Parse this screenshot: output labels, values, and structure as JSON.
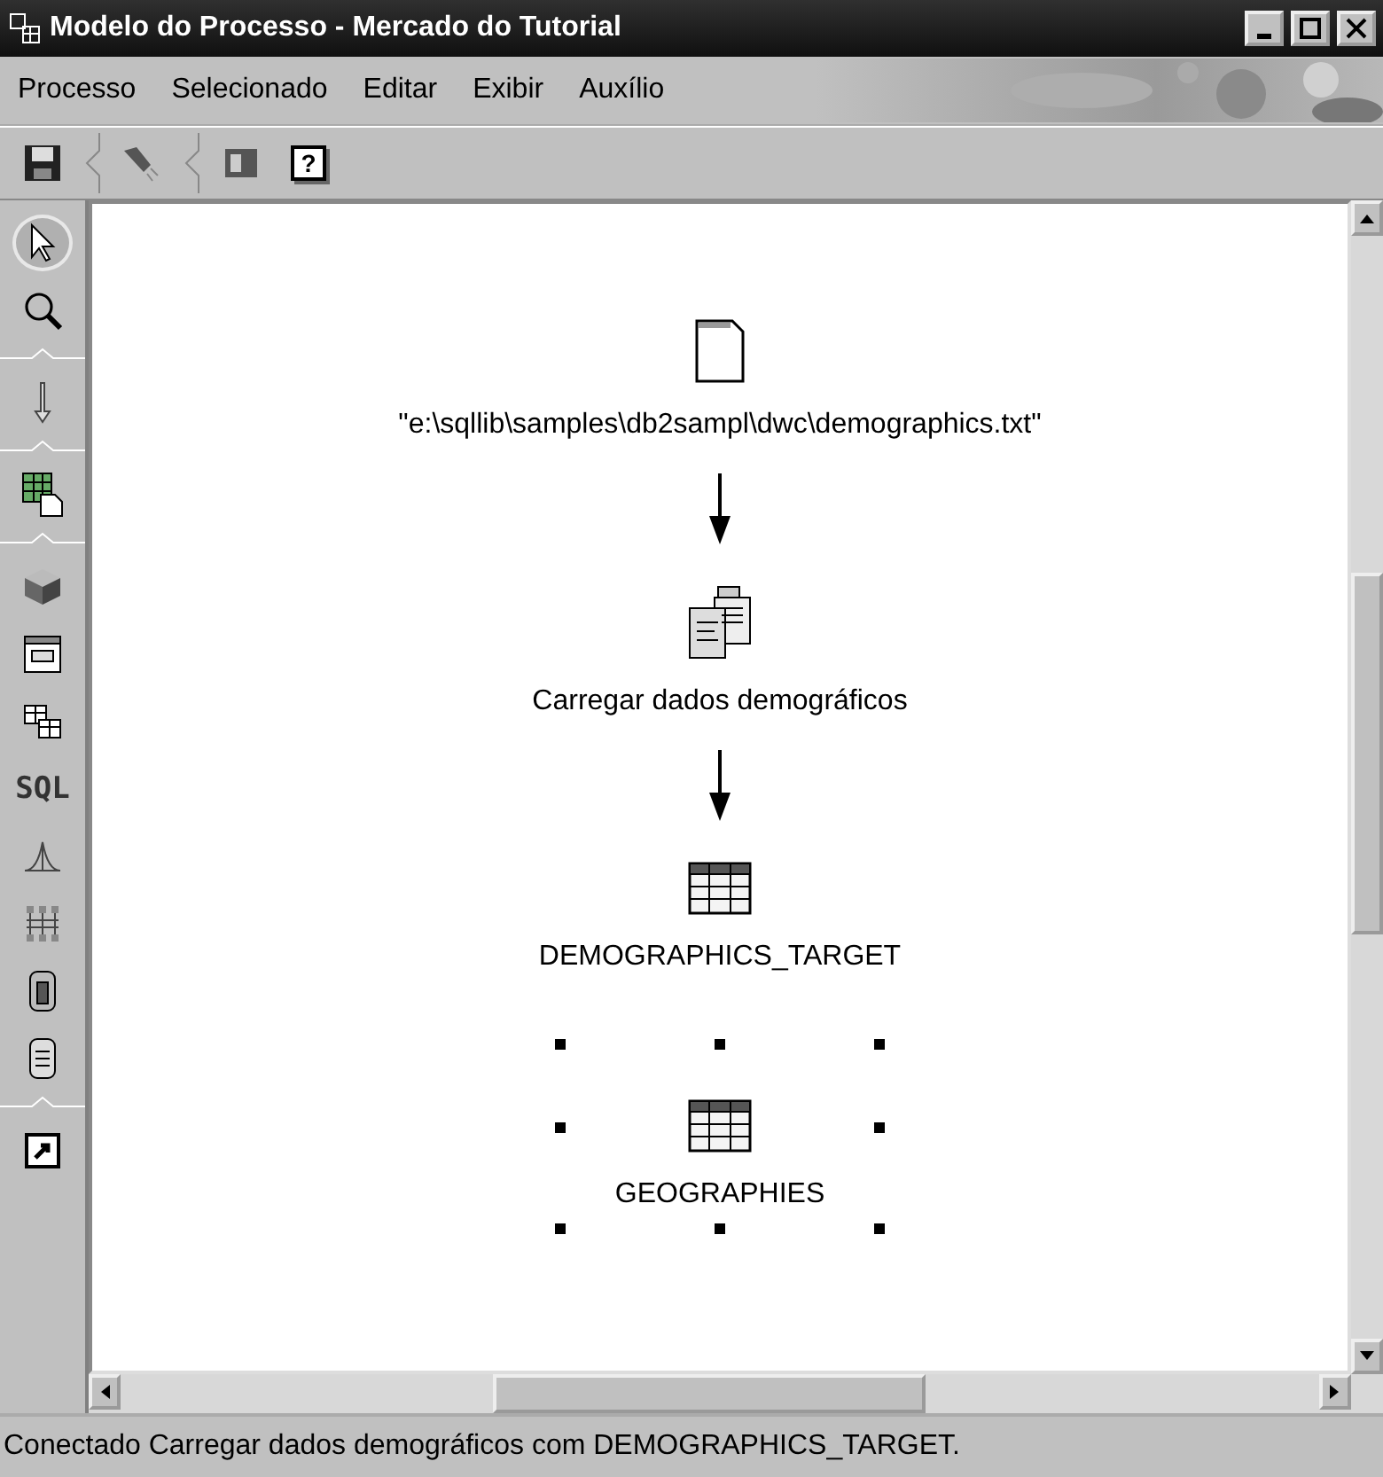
{
  "window": {
    "title": "Modelo do Processo - Mercado do Tutorial"
  },
  "menu": [
    "Processo",
    "Selecionado",
    "Editar",
    "Exibir",
    "Auxílio"
  ],
  "toolbar": {
    "groups": [
      {
        "buttons": [
          {
            "kind": "icon"
          }
        ]
      },
      {
        "buttons": [
          {
            "kind": "icon"
          }
        ]
      },
      {
        "buttons": [
          {
            "kind": "icon"
          },
          {
            "kind": "text",
            "text": "?"
          }
        ]
      }
    ]
  },
  "palette": {
    "groups": [
      {
        "tools": [
          {
            "selected": true
          },
          {
            "selected": false
          }
        ]
      },
      {
        "tools": [
          {
            "selected": false
          }
        ]
      },
      {
        "tools": [
          {
            "selected": false
          }
        ]
      },
      {
        "tools": [
          {
            "selected": false
          },
          {
            "selected": false
          },
          {
            "selected": false
          },
          {
            "selected": false,
            "text": "SQL"
          },
          {
            "selected": false
          },
          {
            "selected": false
          },
          {
            "selected": false
          },
          {
            "selected": false
          }
        ]
      },
      {
        "tools": [
          {
            "selected": false
          }
        ]
      }
    ]
  },
  "diagram": {
    "nodes": [
      {
        "kind": "file",
        "label": "\"e:\\sqllib\\samples\\db2sampl\\dwc\\demographics.txt\"",
        "selected": false,
        "link_below": true
      },
      {
        "kind": "step",
        "label": "Carregar dados demográficos",
        "selected": false,
        "link_below": true
      },
      {
        "kind": "table",
        "label": "DEMOGRAPHICS_TARGET",
        "selected": false,
        "link_below": false
      },
      {
        "kind": "table",
        "label": "GEOGRAPHIES",
        "selected": true,
        "link_below": false
      }
    ]
  },
  "status_bar": "Conectado Carregar dados demográficos com DEMOGRAPHICS_TARGET."
}
